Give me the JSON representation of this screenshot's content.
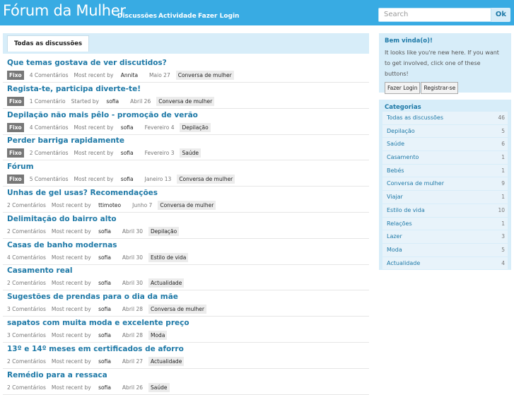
{
  "header": {
    "brand": "Fórum da Mulher",
    "nav": [
      "Discussões",
      "Actividade",
      "Fazer Login"
    ],
    "search_placeholder": "Search",
    "search_button": "Ok"
  },
  "tab": "Todas as discussões",
  "discussions": [
    {
      "title": "Que temas gostava de ver discutidos?",
      "fixo": "Fixo",
      "comments": "4 Comentários",
      "by_label": "Most recent by",
      "author": "Annita",
      "date": "Maio 27",
      "category": "Conversa de mulher"
    },
    {
      "title": "Regista-te, participa diverte-te!",
      "fixo": "Fixo",
      "comments": "1 Comentário",
      "by_label": "Started by",
      "author": "sofia",
      "date": "Abril 26",
      "category": "Conversa de mulher"
    },
    {
      "title": "Depilação não mais pêlo - promoção de verão",
      "fixo": "Fixo",
      "comments": "4 Comentários",
      "by_label": "Most recent by",
      "author": "sofia",
      "date": "Fevereiro 4",
      "category": "Depilação"
    },
    {
      "title": "Perder barriga rapidamente",
      "fixo": "Fixo",
      "comments": "2 Comentários",
      "by_label": "Most recent by",
      "author": "sofia",
      "date": "Fevereiro 3",
      "category": "Saúde"
    },
    {
      "title": "Fórum",
      "fixo": "Fixo",
      "comments": "5 Comentários",
      "by_label": "Most recent by",
      "author": "sofia",
      "date": "Janeiro 13",
      "category": "Conversa de mulher"
    },
    {
      "title": "Unhas de gel usas? Recomendações",
      "fixo": "",
      "comments": "2 Comentários",
      "by_label": "Most recent by",
      "author": "ttimoteo",
      "date": "Junho 7",
      "category": "Conversa de mulher"
    },
    {
      "title": "Delimitação do bairro alto",
      "fixo": "",
      "comments": "2 Comentários",
      "by_label": "Most recent by",
      "author": "sofia",
      "date": "Abril 30",
      "category": "Depilação"
    },
    {
      "title": "Casas de banho modernas",
      "fixo": "",
      "comments": "4 Comentários",
      "by_label": "Most recent by",
      "author": "sofia",
      "date": "Abril 30",
      "category": "Estilo de vida"
    },
    {
      "title": "Casamento real",
      "fixo": "",
      "comments": "2 Comentários",
      "by_label": "Most recent by",
      "author": "sofia",
      "date": "Abril 30",
      "category": "Actualidade"
    },
    {
      "title": "Sugestões de prendas para o dia da mãe",
      "fixo": "",
      "comments": "3 Comentários",
      "by_label": "Most recent by",
      "author": "sofia",
      "date": "Abril 28",
      "category": "Conversa de mulher"
    },
    {
      "title": "sapatos com muita moda e excelente preço",
      "fixo": "",
      "comments": "3 Comentários",
      "by_label": "Most recent by",
      "author": "sofia",
      "date": "Abril 28",
      "category": "Moda"
    },
    {
      "title": "13º e 14º meses em certificados de aforro",
      "fixo": "",
      "comments": "2 Comentários",
      "by_label": "Most recent by",
      "author": "sofia",
      "date": "Abril 27",
      "category": "Actualidade"
    },
    {
      "title": "Remédio para a ressaca",
      "fixo": "",
      "comments": "2 Comentários",
      "by_label": "Most recent by",
      "author": "sofia",
      "date": "Abril 26",
      "category": "Saúde"
    }
  ],
  "welcome": {
    "title": "Bem vinda(o)!",
    "text": "It looks like you're new here. If you want to get involved, click one of these buttons!",
    "login": "Fazer Login",
    "register": "Registrar-se"
  },
  "categories": {
    "title": "Categorias",
    "items": [
      {
        "name": "Todas as discussões",
        "count": "46"
      },
      {
        "name": "Depilação",
        "count": "5"
      },
      {
        "name": "Saúde",
        "count": "6"
      },
      {
        "name": "Casamento",
        "count": "1"
      },
      {
        "name": "Bebés",
        "count": "1"
      },
      {
        "name": "Conversa de mulher",
        "count": "9"
      },
      {
        "name": "Viajar",
        "count": "1"
      },
      {
        "name": "Estilo de vida",
        "count": "10"
      },
      {
        "name": "Relações",
        "count": "1"
      },
      {
        "name": "Lazer",
        "count": "3"
      },
      {
        "name": "Moda",
        "count": "5"
      },
      {
        "name": "Actualidade",
        "count": "4"
      }
    ]
  },
  "colors": {
    "header": "#38abe3",
    "link": "#1e79a7",
    "panel": "#d7edf9"
  }
}
